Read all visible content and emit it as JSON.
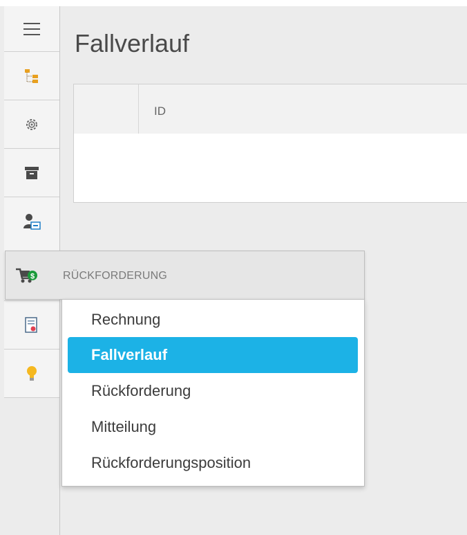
{
  "rail": {
    "items": [
      {
        "name": "menu",
        "icon": "hamburger-menu-icon"
      },
      {
        "name": "hierarchy",
        "icon": "folder-tree-icon"
      },
      {
        "name": "settings",
        "icon": "gear-icon"
      },
      {
        "name": "archive",
        "icon": "archive-box-icon"
      },
      {
        "name": "user",
        "icon": "user-card-icon"
      },
      {
        "name": "recovery",
        "icon": "money-cart-icon"
      },
      {
        "name": "invoice",
        "icon": "document-icon"
      },
      {
        "name": "ideas",
        "icon": "lightbulb-icon"
      }
    ]
  },
  "main": {
    "title": "Fallverlauf",
    "grid": {
      "columns": [
        "",
        "ID"
      ]
    }
  },
  "flyout": {
    "header": "RÜCKFORDERUNG",
    "items": [
      {
        "label": "Rechnung",
        "active": false
      },
      {
        "label": "Fallverlauf",
        "active": true
      },
      {
        "label": "Rückforderung",
        "active": false
      },
      {
        "label": "Mitteilung",
        "active": false
      },
      {
        "label": "Rückforderungsposition",
        "active": false
      }
    ]
  },
  "colors": {
    "accent": "#1cb2e6",
    "background": "#ececec",
    "rail": "#f4f4f4"
  }
}
